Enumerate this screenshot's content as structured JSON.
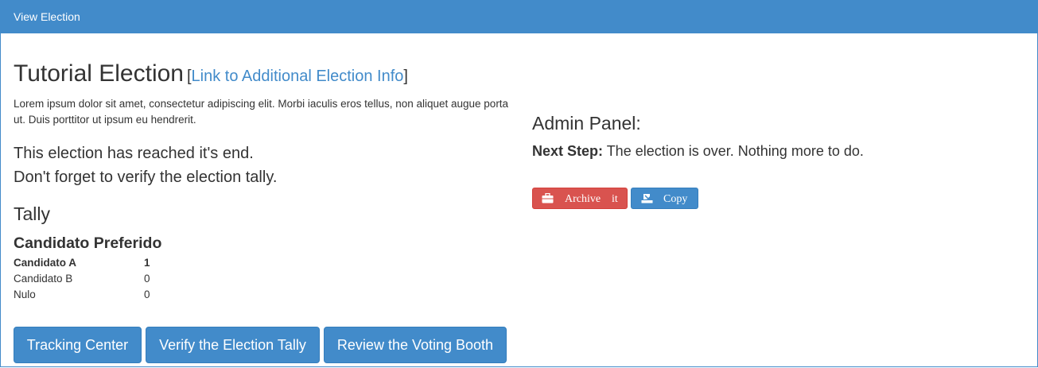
{
  "header": {
    "title": "View Election"
  },
  "election": {
    "name": "Tutorial Election",
    "info_link": "Link to Additional Election Info",
    "bracket_open": "[",
    "bracket_close": "]",
    "description": "Lorem ipsum dolor sit amet, consectetur adipiscing elit. Morbi iaculis eros tellus, non aliquet augue porta ut. Duis porttitor ut ipsum eu hendrerit.",
    "status_line1": "This election has reached it's end.",
    "status_line2": "Don't forget to verify the election tally."
  },
  "tally": {
    "heading": "Tally",
    "question": "Candidato Preferido",
    "rows": [
      {
        "name": "Candidato A",
        "votes": "1",
        "winner": true
      },
      {
        "name": "Candidato B",
        "votes": "0",
        "winner": false
      },
      {
        "name": "Nulo",
        "votes": "0",
        "winner": false
      }
    ]
  },
  "buttons": {
    "tracking": "Tracking Center",
    "verify": "Verify the Election Tally",
    "review": "Review the Voting Booth"
  },
  "admin": {
    "title": "Admin Panel:",
    "next_step_label": "Next Step:",
    "next_step_text": " The election is over. Nothing more to do.",
    "archive_label": "Archive",
    "archive_suffix": "it",
    "copy_label": "Copy"
  },
  "colors": {
    "primary": "#428bca",
    "danger": "#d9534f"
  },
  "icons": {
    "archive": "briefcase-icon",
    "copy": "export-icon"
  }
}
